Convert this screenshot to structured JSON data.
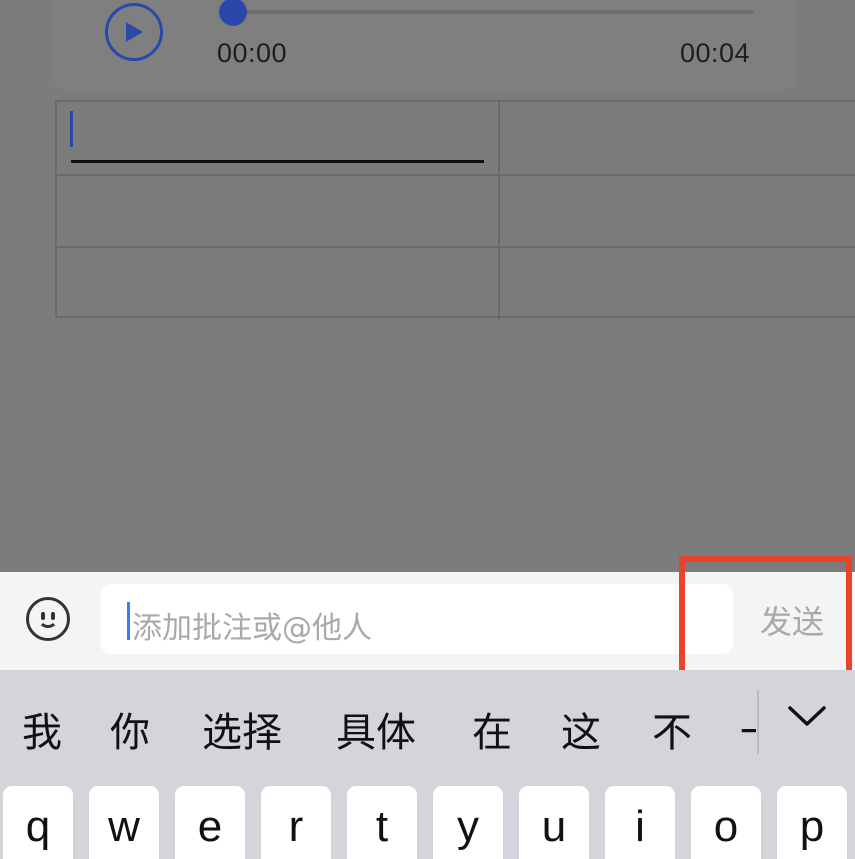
{
  "audio_player": {
    "current_time": "00:00",
    "total_time": "00:04",
    "progress": 0.0
  },
  "comment_bar": {
    "placeholder": "添加批注或@他人",
    "send_label": "发送"
  },
  "keyboard": {
    "candidates": [
      "我",
      "你",
      "选择",
      "具体",
      "在",
      "这",
      "不",
      "一"
    ],
    "keys": [
      "q",
      "w",
      "e",
      "r",
      "t",
      "y",
      "u",
      "i",
      "o",
      "p"
    ]
  },
  "colors": {
    "accent": "#2a48a8",
    "highlight": "#e8432f",
    "caret": "#3b7cf5"
  },
  "icons": {
    "play": "play-icon",
    "emoji": "emoji-icon",
    "collapse": "chevron-down-icon"
  }
}
